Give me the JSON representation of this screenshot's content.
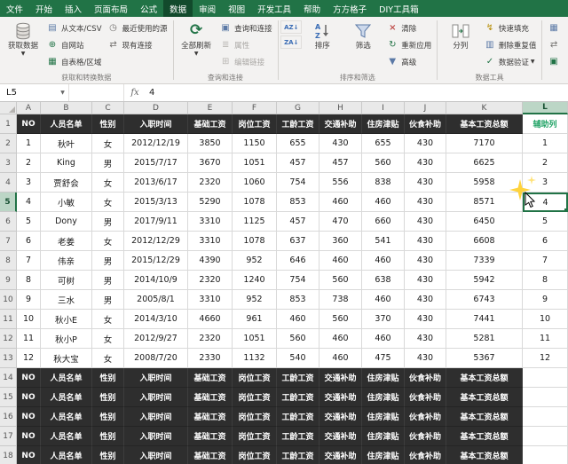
{
  "ribbon": {
    "tabs": [
      "文件",
      "开始",
      "插入",
      "页面布局",
      "公式",
      "数据",
      "审阅",
      "视图",
      "开发工具",
      "帮助",
      "方方格子",
      "DIY工具箱"
    ],
    "active_tab": "数据",
    "get_data": "获取数据",
    "from_text_csv": "从文本/CSV",
    "from_web": "自网站",
    "from_table_range": "自表格/区域",
    "recent_sources": "最近使用的源",
    "existing_connections": "现有连接",
    "group_get_transform": "获取和转换数据",
    "refresh_all": "全部刷新",
    "queries_connections": "查询和连接",
    "properties": "属性",
    "edit_links": "编辑链接",
    "group_queries": "查询和连接",
    "sort_asc_mini": "AZ↓",
    "sort_desc_mini": "ZA↓",
    "sort": "排序",
    "filter": "筛选",
    "clear": "清除",
    "reapply": "重新应用",
    "advanced": "高级",
    "group_sort_filter": "排序和筛选",
    "text_to_columns": "分列",
    "flash_fill": "快速填充",
    "remove_duplicates": "删除重复值",
    "data_validation": "数据验证",
    "group_data_tools": "数据工具"
  },
  "formula_bar": {
    "name_box": "L5",
    "fx_label": "fx",
    "value": "4"
  },
  "sheet": {
    "columns": [
      "A",
      "B",
      "C",
      "D",
      "E",
      "F",
      "G",
      "H",
      "I",
      "J",
      "K",
      "L"
    ],
    "selected": {
      "cell": "L5",
      "column": "L",
      "row": 5,
      "value": "4"
    },
    "table_header": [
      "NO",
      "人员名单",
      "性别",
      "入职时间",
      "基础工资",
      "岗位工资",
      "工龄工资",
      "交通补助",
      "住房津贴",
      "伙食补助",
      "基本工资总额"
    ],
    "aux_column_header": "辅助列",
    "rows": [
      [
        "1",
        "秋叶",
        "女",
        "2012/12/19",
        "3850",
        "1150",
        "655",
        "430",
        "655",
        "430",
        "7170",
        "1"
      ],
      [
        "2",
        "King",
        "男",
        "2015/7/17",
        "3670",
        "1051",
        "457",
        "457",
        "560",
        "430",
        "6625",
        "2"
      ],
      [
        "3",
        "贾舒会",
        "女",
        "2013/6/17",
        "2320",
        "1060",
        "754",
        "556",
        "838",
        "430",
        "5958",
        "3"
      ],
      [
        "4",
        "小敏",
        "女",
        "2015/3/13",
        "5290",
        "1078",
        "853",
        "460",
        "460",
        "430",
        "8571",
        "4"
      ],
      [
        "5",
        "Dony",
        "男",
        "2017/9/11",
        "3310",
        "1125",
        "457",
        "470",
        "660",
        "430",
        "6450",
        "5"
      ],
      [
        "6",
        "老姜",
        "女",
        "2012/12/29",
        "3310",
        "1078",
        "637",
        "360",
        "541",
        "430",
        "6608",
        "6"
      ],
      [
        "7",
        "伟亲",
        "男",
        "2015/12/29",
        "4390",
        "952",
        "646",
        "460",
        "460",
        "430",
        "7339",
        "7"
      ],
      [
        "8",
        "可树",
        "男",
        "2014/10/9",
        "2320",
        "1240",
        "754",
        "560",
        "638",
        "430",
        "5942",
        "8"
      ],
      [
        "9",
        "三水",
        "男",
        "2005/8/1",
        "3310",
        "952",
        "853",
        "738",
        "460",
        "430",
        "6743",
        "9"
      ],
      [
        "10",
        "秋小E",
        "女",
        "2014/3/10",
        "4660",
        "961",
        "460",
        "560",
        "370",
        "430",
        "7441",
        "10"
      ],
      [
        "11",
        "秋小P",
        "女",
        "2012/9/27",
        "2320",
        "1051",
        "560",
        "460",
        "460",
        "430",
        "5281",
        "11"
      ],
      [
        "12",
        "秋大宝",
        "女",
        "2008/7/20",
        "2330",
        "1132",
        "540",
        "460",
        "475",
        "430",
        "5367",
        "12"
      ]
    ],
    "repeated_header_rows": [
      14,
      15,
      16,
      17,
      18
    ]
  }
}
